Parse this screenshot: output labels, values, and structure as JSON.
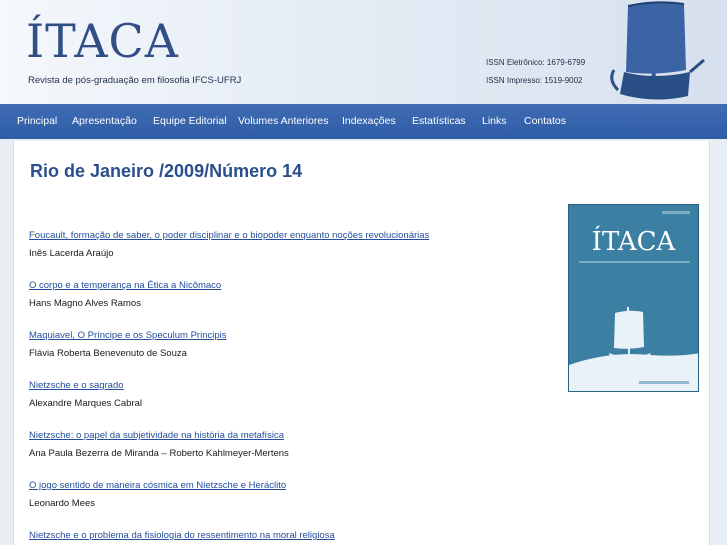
{
  "header": {
    "logo": "ÍTACA",
    "subtitle": "Revista de pós-graduação em filosofia IFCS-UFRJ",
    "issn_eletronico": "ISSN Eletrônico: 1679-6799",
    "issn_impresso": "ISSN Impresso: 1519-9002"
  },
  "nav": {
    "items": [
      "Principal",
      "Apresentação",
      "Equipe Editorial",
      "Volumes Anteriores",
      "Indexações",
      "Estatísticas",
      "Links",
      "Contatos"
    ]
  },
  "main": {
    "title": "Rio de Janeiro /2009/Número 14",
    "cover_logo": "ÍTACA",
    "articles": [
      {
        "title": "Foucault, formação de saber, o poder disciplinar e o biopoder enquanto noções revolucionárias",
        "author": "Inês Lacerda Araújo"
      },
      {
        "title": "O corpo e a temperança na Ética a Nicômaco",
        "author": "Hans Magno Alves Ramos"
      },
      {
        "title": "Maquiavel, O Príncipe e os Speculum Principis",
        "author": "Flávia Roberta Benevenuto de Souza"
      },
      {
        "title": "Nietzsche e o sagrado",
        "author": "Alexandre Marques Cabral"
      },
      {
        "title": "Nietzsche: o papel da subjetividade na história da metafísica",
        "author": "Ana Paula Bezerra de Miranda – Roberto Kahlmeyer-Mertens"
      },
      {
        "title": "O jogo sentido de maneira cósmica em Nietzsche e Heráclito",
        "author": "Leonardo Mees"
      },
      {
        "title": "Nietzsche e o problema da fisiologia do ressentimento na moral religiosa",
        "author": ""
      }
    ]
  }
}
